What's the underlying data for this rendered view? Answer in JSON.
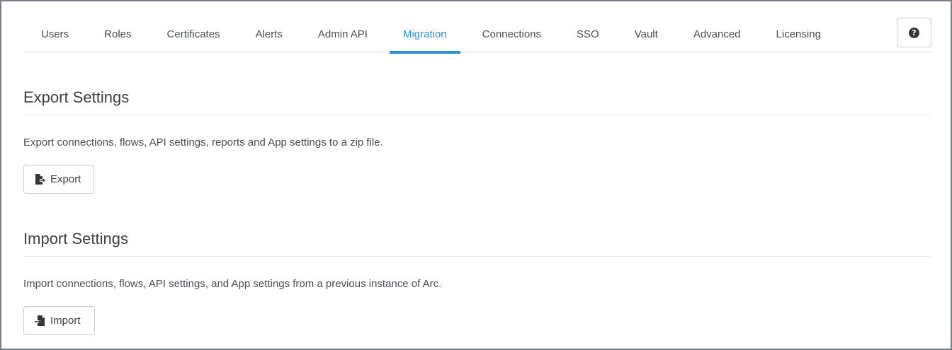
{
  "tabs": [
    {
      "label": "Users",
      "active": false
    },
    {
      "label": "Roles",
      "active": false
    },
    {
      "label": "Certificates",
      "active": false
    },
    {
      "label": "Alerts",
      "active": false
    },
    {
      "label": "Admin API",
      "active": false
    },
    {
      "label": "Migration",
      "active": true
    },
    {
      "label": "Connections",
      "active": false
    },
    {
      "label": "SSO",
      "active": false
    },
    {
      "label": "Vault",
      "active": false
    },
    {
      "label": "Advanced",
      "active": false
    },
    {
      "label": "Licensing",
      "active": false
    }
  ],
  "help": {
    "icon": "question-circle-icon",
    "glyph": "?"
  },
  "export": {
    "title": "Export Settings",
    "description": "Export connections, flows, API settings, reports and App settings to a zip file.",
    "button_label": "Export",
    "button_icon": "file-export-icon"
  },
  "import": {
    "title": "Import Settings",
    "description": "Import connections, flows, API settings, and App settings from a previous instance of Arc.",
    "button_label": "Import",
    "button_icon": "file-import-icon"
  },
  "colors": {
    "accent": "#2e8fd1",
    "text": "#4a4d52",
    "border": "#c9cdd2"
  }
}
